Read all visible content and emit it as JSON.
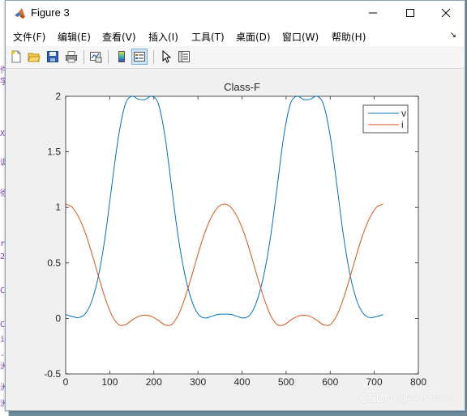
{
  "window": {
    "title": "Figure 3"
  },
  "menu": {
    "items": [
      "文件(F)",
      "编辑(E)",
      "查看(V)",
      "插入(I)",
      "工具(T)",
      "桌面(D)",
      "窗口(W)",
      "帮助(H)"
    ]
  },
  "toolbar": {
    "icons": [
      "new-figure",
      "open-file",
      "save",
      "print",
      "link-plot",
      "colorbar",
      "legend",
      "edit-plot-arrow",
      "property-inspector"
    ]
  },
  "background": {
    "left_glyphs": [
      "件",
      "学",
      "XF",
      "讽",
      "徐",
      "r",
      "2:",
      "C",
      "C",
      "i",
      "-i",
      "洲",
      "洲",
      "洲"
    ]
  },
  "chart_data": {
    "type": "line",
    "title": "Class-F",
    "xlabel": "",
    "ylabel": "",
    "xlim": [
      0,
      800
    ],
    "ylim": [
      -0.5,
      2
    ],
    "xticks": [
      "0",
      "100",
      "200",
      "300",
      "400",
      "500",
      "600",
      "700",
      "800"
    ],
    "yticks": [
      "-0.5",
      "0",
      "0.5",
      "1",
      "1.5",
      "2"
    ],
    "grid": false,
    "legend": "top-right",
    "x": [
      0,
      15,
      30,
      45,
      60,
      75,
      90,
      105,
      120,
      135,
      150,
      165,
      180,
      195,
      210,
      225,
      240,
      255,
      270,
      285,
      300,
      315,
      330,
      345,
      360,
      375,
      390,
      405,
      420,
      435,
      450,
      465,
      480,
      495,
      510,
      525,
      540,
      555,
      570,
      585,
      600,
      615,
      630,
      645,
      660,
      675,
      690,
      705,
      720
    ],
    "series": [
      {
        "name": "v",
        "color": "#0072bd",
        "values": [
          0.035,
          0.016,
          0.008,
          0.044,
          0.164,
          0.395,
          0.749,
          1.207,
          1.642,
          1.925,
          2.0,
          1.974,
          1.971,
          2.0,
          1.935,
          1.649,
          1.192,
          0.741,
          0.401,
          0.171,
          0.041,
          0.004,
          0.017,
          0.036,
          0.038,
          0.036,
          0.017,
          0.004,
          0.041,
          0.171,
          0.401,
          0.741,
          1.192,
          1.649,
          1.935,
          2.0,
          1.971,
          1.974,
          2.0,
          1.925,
          1.642,
          1.207,
          0.749,
          0.395,
          0.164,
          0.044,
          0.008,
          0.016,
          0.035
        ]
      },
      {
        "name": "i",
        "color": "#d95319",
        "values": [
          1.03,
          1.0,
          0.908,
          0.764,
          0.577,
          0.371,
          0.178,
          0.026,
          -0.056,
          -0.058,
          -0.017,
          0.017,
          0.029,
          0.017,
          -0.017,
          -0.058,
          -0.056,
          0.026,
          0.178,
          0.371,
          0.577,
          0.764,
          0.908,
          1.0,
          1.03,
          1.0,
          0.908,
          0.764,
          0.577,
          0.371,
          0.178,
          0.026,
          -0.056,
          -0.058,
          -0.017,
          0.017,
          0.029,
          0.017,
          -0.017,
          -0.058,
          -0.056,
          0.026,
          0.178,
          0.371,
          0.577,
          0.764,
          0.908,
          1.0,
          1.03
        ]
      }
    ]
  },
  "watermark": "CSDN @怡步晓心l"
}
